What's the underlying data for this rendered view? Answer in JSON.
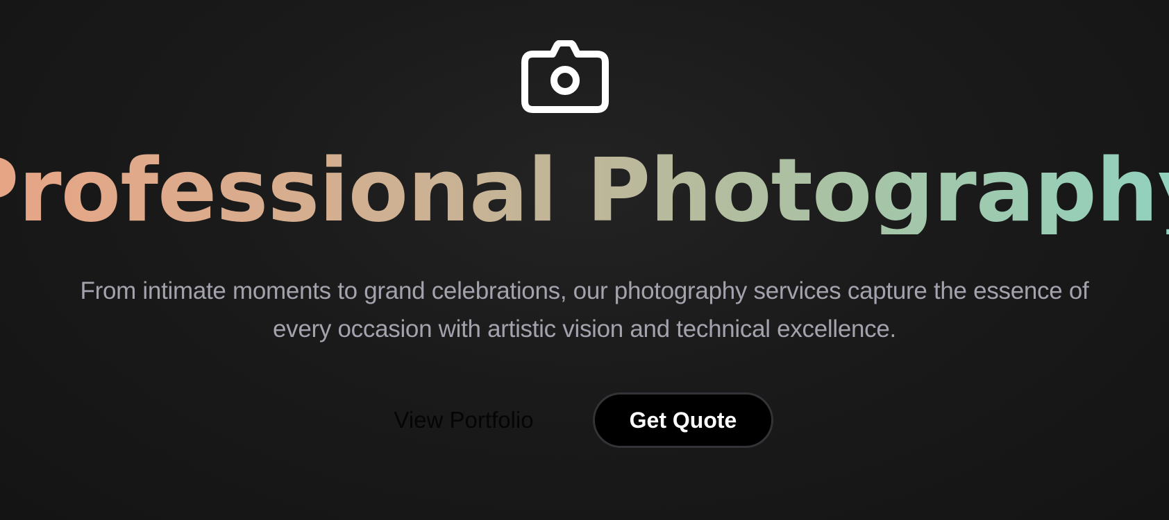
{
  "hero": {
    "icon": "camera-icon",
    "title": "Professional Photography",
    "subtitle": "From intimate moments to grand celebrations, our photography services capture the essence of every occasion with artistic vision and technical excellence.",
    "title_gradient": [
      "#e9a485",
      "#8fd4c1"
    ],
    "subtitle_color": "#a3a3ae"
  },
  "actions": {
    "view_portfolio_label": "View Portfolio",
    "get_quote_label": "Get Quote"
  },
  "colors": {
    "background": "#1a1a1a",
    "button_background": "#000000",
    "button_border": "#333438",
    "button_text": "#ffffff"
  }
}
